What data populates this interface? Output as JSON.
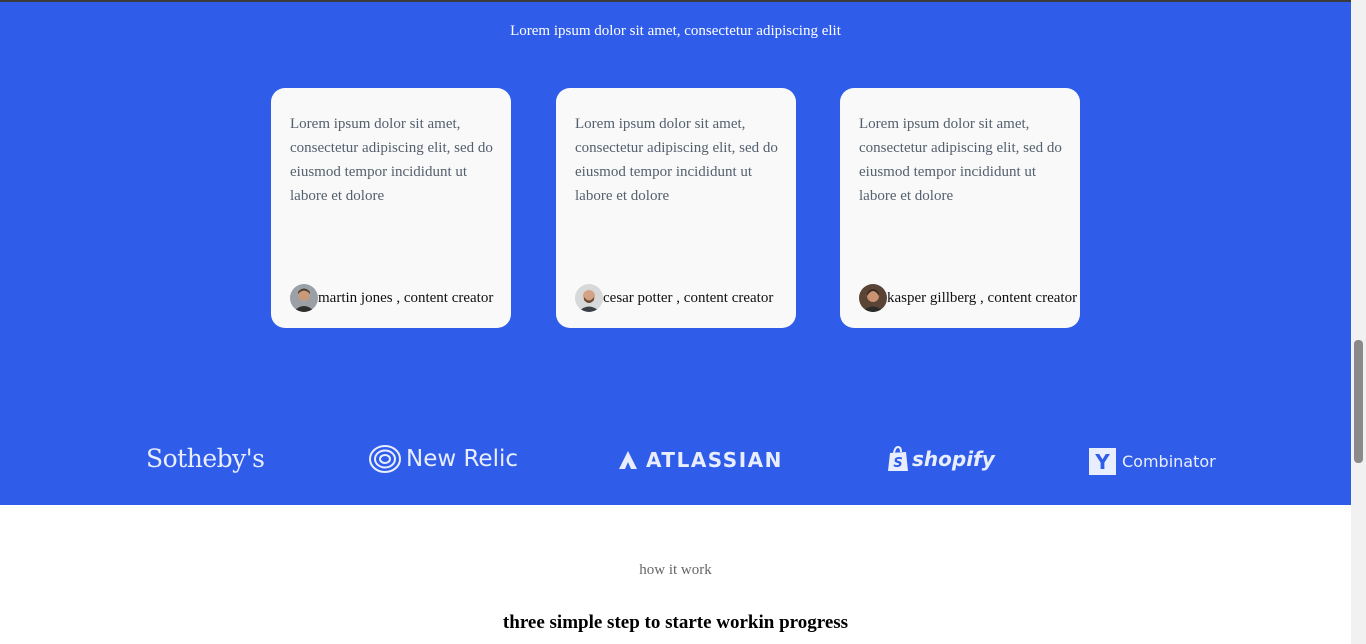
{
  "testimonials": {
    "subtitle": "Lorem ipsum dolor sit amet, consectetur adipiscing elit",
    "cards": [
      {
        "text": "Lorem ipsum dolor sit amet, consectetur adipiscing elit, sed do eiusmod tempor incididunt ut labore et dolore",
        "author": "martin jones , content creator"
      },
      {
        "text": "Lorem ipsum dolor sit amet, consectetur adipiscing elit, sed do eiusmod tempor incididunt ut labore et dolore",
        "author": "cesar potter , content creator"
      },
      {
        "text": "Lorem ipsum dolor sit amet, consectetur adipiscing elit, sed do eiusmod tempor incididunt ut labore et dolore",
        "author": "kasper gillberg , content creator"
      }
    ]
  },
  "logos": {
    "sothebys": "Sotheby's",
    "newrelic": "New Relic",
    "atlassian": "ATLASSIAN",
    "shopify": "shopify",
    "yc_mark": "Y",
    "yc_text": "Combinator"
  },
  "how_it_works": {
    "eyebrow": "how it work",
    "headline": "three simple step to starte workin progress"
  },
  "colors": {
    "brand_blue": "#2f5dea",
    "card_bg": "#f9f9f9"
  }
}
